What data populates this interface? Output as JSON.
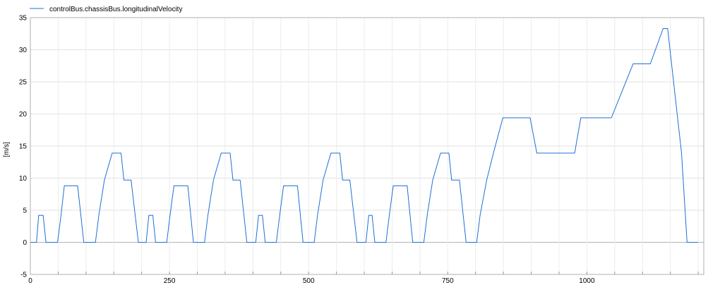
{
  "chart_data": {
    "type": "line",
    "title": "",
    "xlabel": "",
    "ylabel": "[m/s]",
    "xlim": [
      0,
      1210
    ],
    "ylim": [
      -5,
      35
    ],
    "xticks": [
      0,
      250,
      500,
      750,
      1000
    ],
    "yticks": [
      -5,
      0,
      5,
      10,
      15,
      20,
      25,
      30,
      35
    ],
    "grid": true,
    "legend_position": "top-left",
    "series": [
      {
        "name": "controlBus.chassisBus.longitudinalVelocity",
        "color": "#1f6fd6",
        "points": [
          [
            0,
            0
          ],
          [
            11,
            0
          ],
          [
            15,
            4.2
          ],
          [
            23,
            4.2
          ],
          [
            28,
            0
          ],
          [
            49,
            0
          ],
          [
            55,
            4.2
          ],
          [
            61,
            8.8
          ],
          [
            85,
            8.8
          ],
          [
            96,
            0
          ],
          [
            117,
            0
          ],
          [
            123,
            4.2
          ],
          [
            133,
            9.7
          ],
          [
            147,
            13.9
          ],
          [
            163,
            13.9
          ],
          [
            168,
            9.7
          ],
          [
            181,
            9.7
          ],
          [
            194,
            0
          ],
          [
            208,
            0
          ],
          [
            213,
            4.2
          ],
          [
            220,
            4.2
          ],
          [
            225,
            0
          ],
          [
            245,
            0
          ],
          [
            251,
            4.2
          ],
          [
            258,
            8.8
          ],
          [
            283,
            8.8
          ],
          [
            293,
            0
          ],
          [
            313,
            0
          ],
          [
            319,
            4.2
          ],
          [
            329,
            9.7
          ],
          [
            343,
            13.9
          ],
          [
            359,
            13.9
          ],
          [
            364,
            9.7
          ],
          [
            377,
            9.7
          ],
          [
            389,
            0
          ],
          [
            405,
            0
          ],
          [
            410,
            4.2
          ],
          [
            417,
            4.2
          ],
          [
            422,
            0
          ],
          [
            442,
            0
          ],
          [
            448,
            4.2
          ],
          [
            455,
            8.8
          ],
          [
            480,
            8.8
          ],
          [
            490,
            0
          ],
          [
            510,
            0
          ],
          [
            516,
            4.2
          ],
          [
            526,
            9.7
          ],
          [
            540,
            13.9
          ],
          [
            556,
            13.9
          ],
          [
            561,
            9.7
          ],
          [
            574,
            9.7
          ],
          [
            587,
            0
          ],
          [
            603,
            0
          ],
          [
            608,
            4.2
          ],
          [
            614,
            4.2
          ],
          [
            619,
            0
          ],
          [
            639,
            0
          ],
          [
            645,
            4.2
          ],
          [
            652,
            8.8
          ],
          [
            677,
            8.8
          ],
          [
            687,
            0
          ],
          [
            707,
            0
          ],
          [
            713,
            4.2
          ],
          [
            723,
            9.7
          ],
          [
            737,
            13.9
          ],
          [
            752,
            13.9
          ],
          [
            757,
            9.7
          ],
          [
            771,
            9.7
          ],
          [
            783,
            0
          ],
          [
            802,
            0
          ],
          [
            808,
            4.2
          ],
          [
            820,
            9.7
          ],
          [
            832,
            13.9
          ],
          [
            849,
            19.4
          ],
          [
            898,
            19.4
          ],
          [
            910,
            13.9
          ],
          [
            978,
            13.9
          ],
          [
            989,
            19.4
          ],
          [
            1044,
            19.4
          ],
          [
            1083,
            27.8
          ],
          [
            1114,
            27.8
          ],
          [
            1137,
            33.3
          ],
          [
            1145,
            33.3
          ],
          [
            1170,
            13.9
          ],
          [
            1180,
            0
          ],
          [
            1200,
            0
          ]
        ]
      }
    ]
  }
}
